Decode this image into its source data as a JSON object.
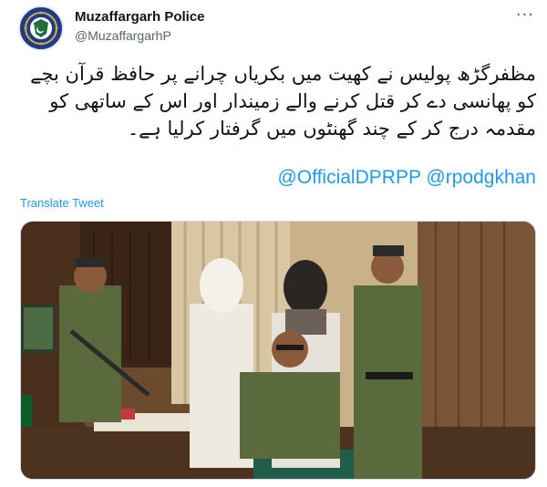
{
  "author": {
    "name": "Muzaffargarh Police",
    "handle": "@MuzaffargarhP",
    "avatar_icon": "police-badge-icon"
  },
  "menu": {
    "more_icon": "more-options-icon",
    "more_label": "···"
  },
  "tweet": {
    "text": "مظفرگڑھ پولیس نے کھیت میں بکریاں چرانے پر حافظ قرآن بچے کو پھانسی دے کر قتل کرنے والے زمیندار اور اس کے ساتھی کو مقدمہ درج کر کے چند گھنٹوں میں گرفتار کرلیا ہے۔",
    "mentions": [
      "@OfficialDPRPP",
      "@rpodgkhan"
    ],
    "translate_label": "Translate Tweet"
  },
  "colors": {
    "link": "#1d9bf0",
    "muted": "#536471",
    "uniform": "#5b6a3c"
  }
}
